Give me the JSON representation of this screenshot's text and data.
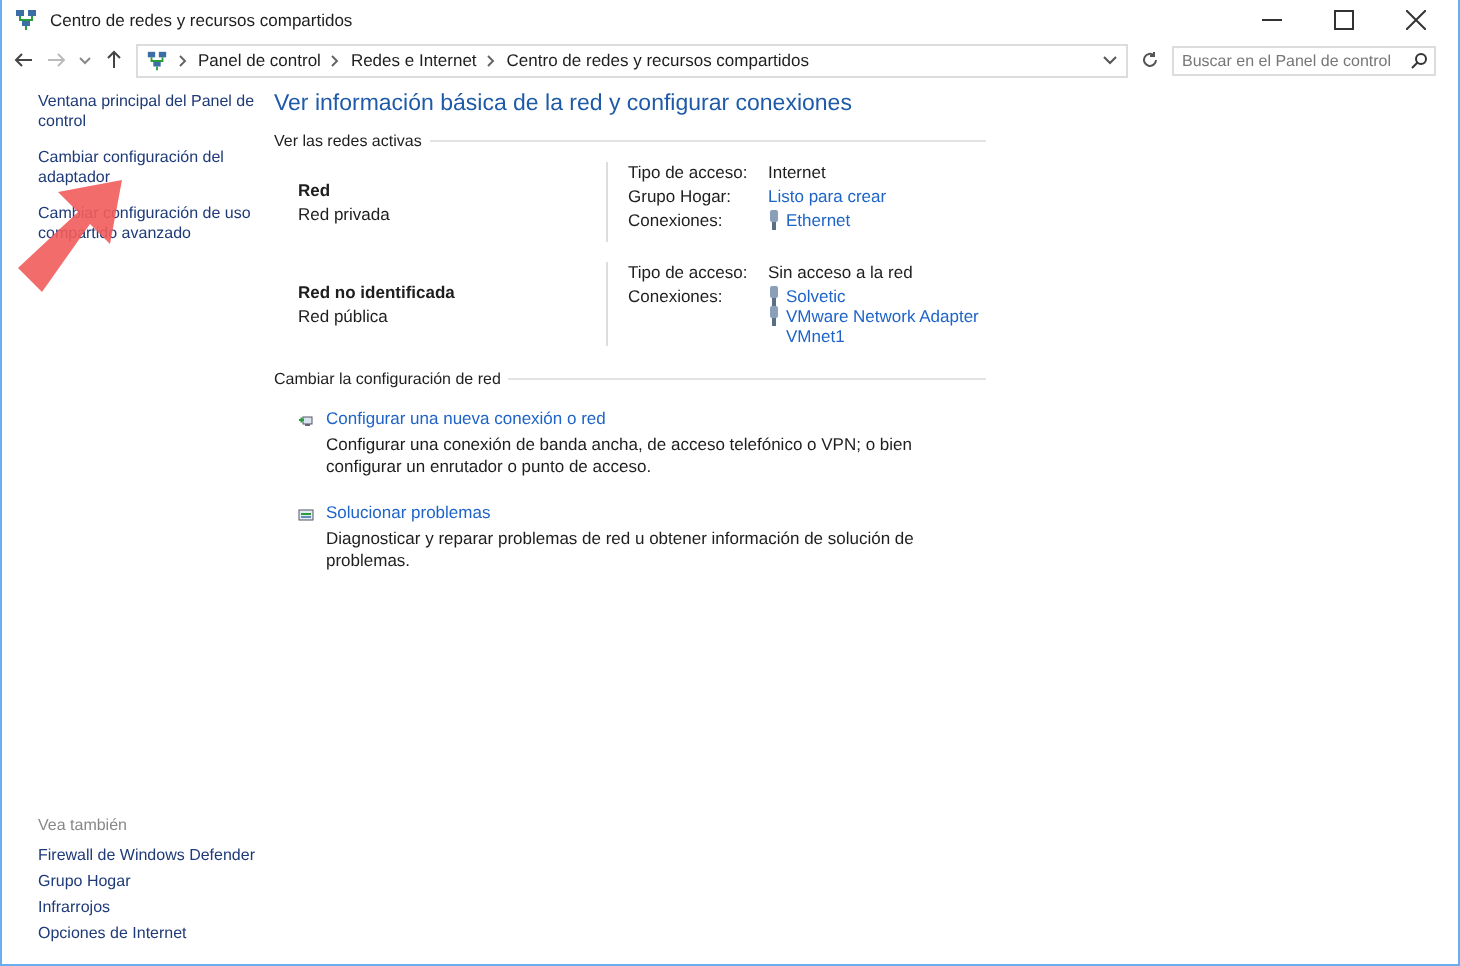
{
  "window": {
    "title": "Centro de redes y recursos compartidos"
  },
  "address_bar": {
    "breadcrumbs": [
      "Panel de control",
      "Redes e Internet",
      "Centro de redes y recursos compartidos"
    ],
    "search_placeholder": "Buscar en el Panel de control"
  },
  "sidebar": {
    "links": [
      "Ventana principal del Panel de control",
      "Cambiar configuración del adaptador",
      "Cambiar configuración de uso compartido avanzado"
    ],
    "see_also_title": "Vea también",
    "see_also": [
      "Firewall de Windows Defender",
      "Grupo Hogar",
      "Infrarrojos",
      "Opciones de Internet"
    ]
  },
  "main": {
    "heading": "Ver información básica de la red y configurar conexiones",
    "active_networks_title": "Ver las redes activas",
    "networks": [
      {
        "name": "Red",
        "type": "Red privada",
        "props": [
          {
            "label": "Tipo de acceso:",
            "value": "Internet",
            "kind": "text"
          },
          {
            "label": "Grupo Hogar:",
            "value": "Listo para crear",
            "kind": "link"
          },
          {
            "label": "Conexiones:",
            "kind": "connections",
            "connections": [
              "Ethernet"
            ]
          }
        ]
      },
      {
        "name": "Red no identificada",
        "type": "Red pública",
        "props": [
          {
            "label": "Tipo de acceso:",
            "value": "Sin acceso a la red",
            "kind": "text"
          },
          {
            "label": "Conexiones:",
            "kind": "connections",
            "connections": [
              "Solvetic",
              "VMware Network Adapter VMnet1"
            ]
          }
        ]
      }
    ],
    "change_title": "Cambiar la configuración de red",
    "tasks": [
      {
        "kind": "new-connection",
        "title": "Configurar una nueva conexión o red",
        "description": "Configurar una conexión de banda ancha, de acceso telefónico o VPN; o bien configurar un enrutador o punto de acceso."
      },
      {
        "kind": "troubleshoot",
        "title": "Solucionar problemas",
        "description": "Diagnosticar y reparar problemas de red u obtener información de solución de problemas."
      }
    ]
  },
  "annotation_arrow": true
}
